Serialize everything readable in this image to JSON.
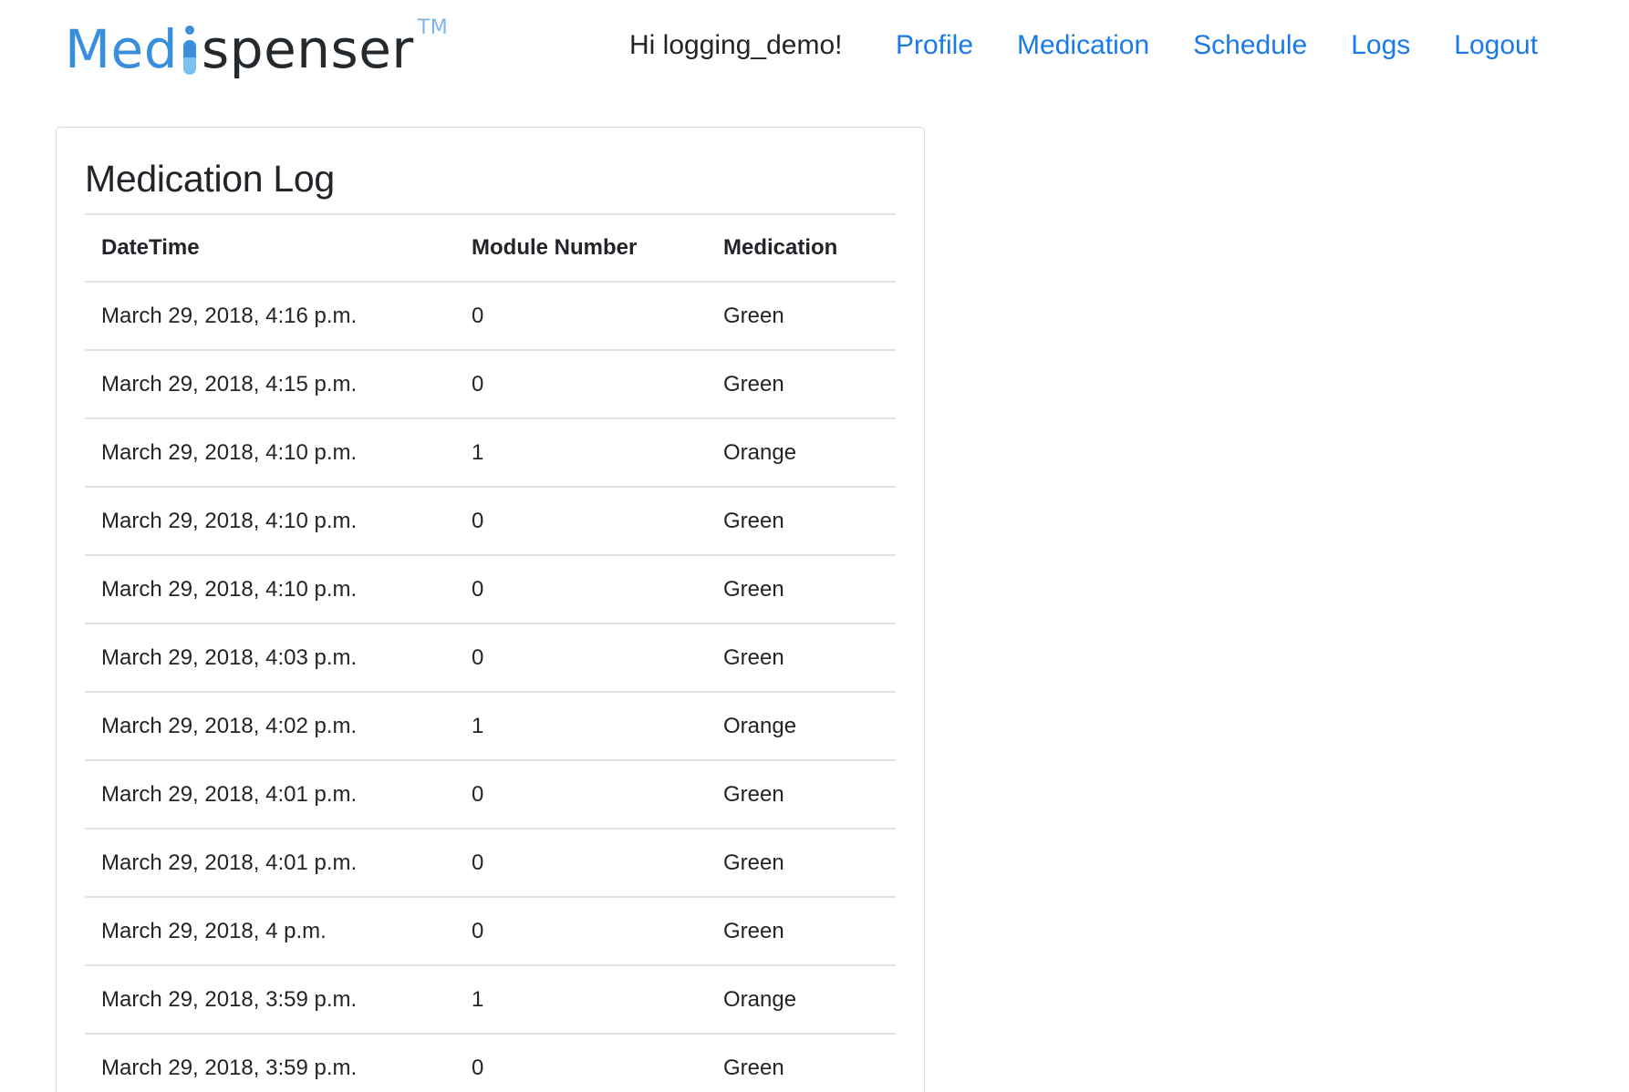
{
  "header": {
    "brand": {
      "part1": "Med",
      "part2": "spenser",
      "tm": "TM"
    },
    "greeting": "Hi logging_demo!",
    "nav": [
      {
        "label": "Profile"
      },
      {
        "label": "Medication"
      },
      {
        "label": "Schedule"
      },
      {
        "label": "Logs"
      },
      {
        "label": "Logout"
      }
    ]
  },
  "main": {
    "title": "Medication Log",
    "table": {
      "columns": [
        "DateTime",
        "Module Number",
        "Medication"
      ],
      "rows": [
        [
          "March 29, 2018, 4:16 p.m.",
          "0",
          "Green"
        ],
        [
          "March 29, 2018, 4:15 p.m.",
          "0",
          "Green"
        ],
        [
          "March 29, 2018, 4:10 p.m.",
          "1",
          "Orange"
        ],
        [
          "March 29, 2018, 4:10 p.m.",
          "0",
          "Green"
        ],
        [
          "March 29, 2018, 4:10 p.m.",
          "0",
          "Green"
        ],
        [
          "March 29, 2018, 4:03 p.m.",
          "0",
          "Green"
        ],
        [
          "March 29, 2018, 4:02 p.m.",
          "1",
          "Orange"
        ],
        [
          "March 29, 2018, 4:01 p.m.",
          "0",
          "Green"
        ],
        [
          "March 29, 2018, 4:01 p.m.",
          "0",
          "Green"
        ],
        [
          "March 29, 2018, 4 p.m.",
          "0",
          "Green"
        ],
        [
          "March 29, 2018, 3:59 p.m.",
          "1",
          "Orange"
        ],
        [
          "March 29, 2018, 3:59 p.m.",
          "0",
          "Green"
        ]
      ]
    }
  },
  "colors": {
    "brand_blue": "#3a8fdc",
    "link_blue": "#1a7be8",
    "text": "#212529",
    "border": "#dee2e6"
  }
}
